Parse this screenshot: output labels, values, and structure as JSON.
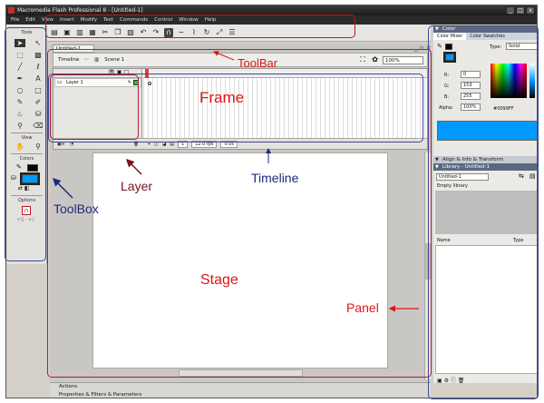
{
  "window": {
    "title": "Macromedia Flash Professional 8 - [Untitled-1]",
    "controls": [
      "_",
      "□",
      "x"
    ]
  },
  "menu": [
    "File",
    "Edit",
    "View",
    "Insert",
    "Modify",
    "Text",
    "Commands",
    "Control",
    "Window",
    "Help"
  ],
  "toolbar": {
    "icons": [
      "new",
      "open",
      "save",
      "print",
      "cut",
      "copy",
      "paste",
      "undo",
      "redo",
      "snap",
      "smooth",
      "straighten",
      "rotate",
      "scale",
      "align"
    ]
  },
  "toolbox": {
    "header": "Tools",
    "view_label": "View",
    "colors_label": "Colors",
    "options_label": "Options"
  },
  "document": {
    "tab": "Untitled-1",
    "timeline_btn": "Timeline",
    "scene": "Scene 1",
    "zoom": "100%",
    "layer_name": "Layer 1"
  },
  "timeline_status": {
    "frame": "1",
    "fps": "12.0 fps",
    "time": "0.0s"
  },
  "panels": {
    "color": {
      "title": "Color",
      "tabs": [
        "Color Mixer",
        "Color Swatches"
      ],
      "type_label": "Type:",
      "type_value": "Solid",
      "r_label": "R:",
      "r": "0",
      "g_label": "G:",
      "g": "153",
      "b_label": "B:",
      "b": "255",
      "alpha_label": "Alpha:",
      "alpha": "100%",
      "hex": "#0099FF"
    },
    "align_title": "Align & Info & Transform",
    "library": {
      "title": "Library - Untitled-1",
      "selector": "Untitled-1",
      "empty": "Empty library",
      "col_name": "Name",
      "col_type": "Type"
    }
  },
  "bottom_panels": [
    "Actions",
    "Properties & Filters & Parameters"
  ],
  "annotations": {
    "toolbar": "ToolBar",
    "frame": "Frame",
    "layer": "Layer",
    "timeline": "Timeline",
    "toolbox": "ToolBox",
    "stage": "Stage",
    "panel": "Panel"
  },
  "colors": {
    "annotation_red": "#e01414",
    "annotation_navy": "#1d2a7a",
    "fill_color": "#0099FF",
    "box_red": "#b51a2a",
    "box_blue": "#3d4a9a"
  }
}
